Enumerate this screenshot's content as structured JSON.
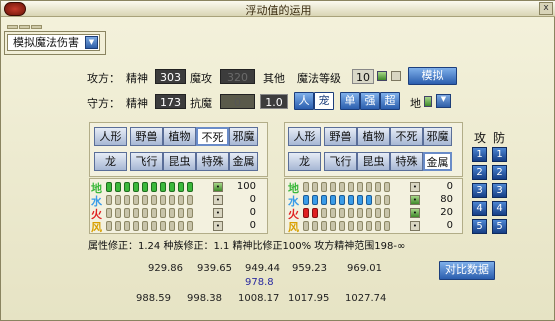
{
  "window": {
    "title": "浮动值的运用",
    "close_label": "x"
  },
  "mode_select": {
    "value": "模拟魔法伤害"
  },
  "attack_row": {
    "label": "攻方：",
    "spirit_label": "精神",
    "spirit_value": "303",
    "magic_atk_label": "魔攻",
    "magic_atk_value": "320",
    "other_label": "其他",
    "magic_level_label": "魔法等级",
    "magic_level_value": "10",
    "simulate_button": "模拟"
  },
  "defense_row": {
    "label": "守方：",
    "spirit_label": "精神",
    "spirit_value": "173",
    "magic_def_label": "抗魔",
    "magic_def_value": "0",
    "mult_value": "1.0",
    "btn_ren": "人",
    "btn_chong": "宠",
    "btn_dan": "单",
    "btn_qiang": "强",
    "btn_chao": "超",
    "element_label": "地"
  },
  "left_races": [
    "人形",
    "野兽",
    "植物",
    "不死",
    "邪魔",
    "龙",
    "飞行",
    "昆虫",
    "特殊",
    "金属"
  ],
  "left_selected": "不死",
  "right_races": [
    "人形",
    "野兽",
    "植物",
    "不死",
    "邪魔",
    "龙",
    "飞行",
    "昆虫",
    "特殊",
    "金属"
  ],
  "right_selected": "金属",
  "left_elements": [
    {
      "name": "地",
      "color": "#3cb83c",
      "filled": 10,
      "value": "100"
    },
    {
      "name": "水",
      "color": "#3a9ce8",
      "filled": 0,
      "value": "0"
    },
    {
      "name": "火",
      "color": "#e02020",
      "filled": 0,
      "value": "0"
    },
    {
      "name": "风",
      "color": "#d8a000",
      "filled": 0,
      "value": "0"
    }
  ],
  "right_elements": [
    {
      "name": "地",
      "color": "#3cb83c",
      "filled": 0,
      "value": "0"
    },
    {
      "name": "水",
      "color": "#3a9ce8",
      "filled": 8,
      "value": "80"
    },
    {
      "name": "火",
      "color": "#e02020",
      "filled": 2,
      "value": "20"
    },
    {
      "name": "风",
      "color": "#d8a000",
      "filled": 0,
      "value": "0"
    }
  ],
  "side_labels": {
    "attack": "攻",
    "defense": "防"
  },
  "side_numbers": [
    "1",
    "2",
    "3",
    "4",
    "5"
  ],
  "correction_text": "属性修正：1.24 种族修正：1.1 精神比修正100% 攻方精神范围198-∞",
  "results": {
    "row1": [
      "929.86",
      "939.65",
      "949.44",
      "959.23",
      "969.01"
    ],
    "middle": "978.8",
    "row2": [
      "988.59",
      "998.38",
      "1008.17",
      "1017.95",
      "1027.74"
    ]
  },
  "compare_button": "对比数据"
}
